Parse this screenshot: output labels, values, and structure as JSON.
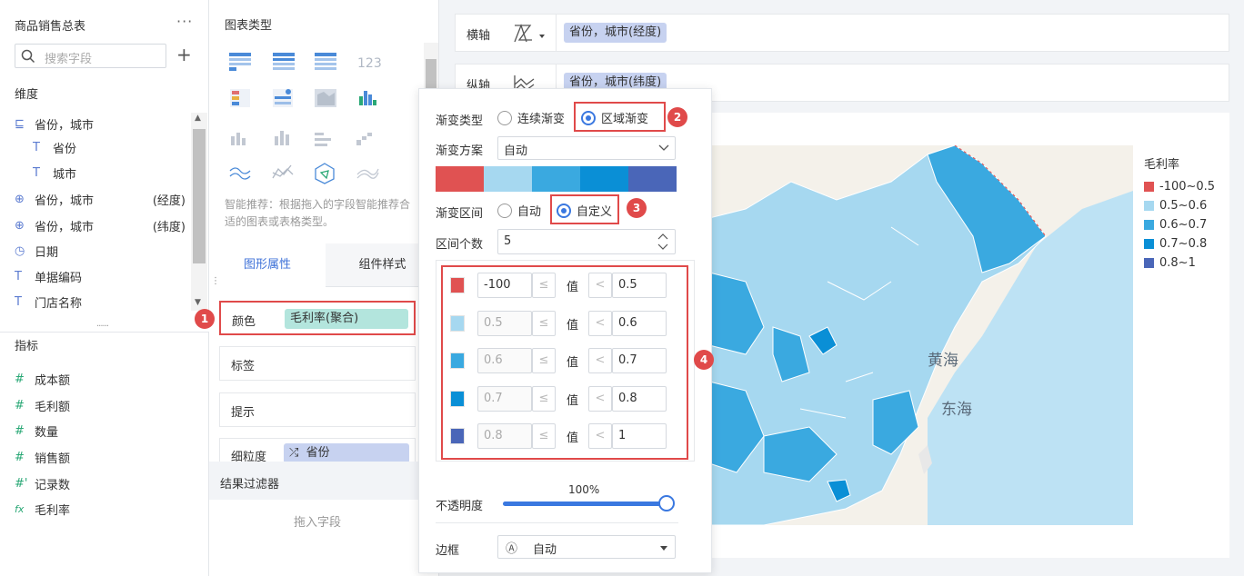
{
  "left": {
    "title": "商品销售总表",
    "more": "···",
    "search_placeholder": "搜索字段",
    "add": "+",
    "dim_label": "维度",
    "dims": [
      {
        "label": "省份，城市",
        "sub": "",
        "icon": "hierarchy-icon"
      },
      {
        "label": "省份",
        "sub": "",
        "icon": "text-field-icon"
      },
      {
        "label": "城市",
        "sub": "",
        "icon": "text-field-icon"
      },
      {
        "label": "省份，城市",
        "sub": "(经度)",
        "icon": "globe-icon"
      },
      {
        "label": "省份，城市",
        "sub": "(纬度)",
        "icon": "globe-icon"
      },
      {
        "label": "日期",
        "sub": "",
        "icon": "clock-icon"
      },
      {
        "label": "单据编码",
        "sub": "",
        "icon": "text-field-icon"
      },
      {
        "label": "门店名称",
        "sub": "",
        "icon": "text-field-icon"
      }
    ],
    "measure_label": "指标",
    "measures": [
      {
        "label": "成本额",
        "icon": "number-field-icon"
      },
      {
        "label": "毛利额",
        "icon": "number-field-icon"
      },
      {
        "label": "数量",
        "icon": "number-field-icon"
      },
      {
        "label": "销售额",
        "icon": "number-field-icon"
      },
      {
        "label": "记录数",
        "icon": "record-count-icon"
      },
      {
        "label": "毛利率",
        "icon": "formula-field-icon"
      }
    ]
  },
  "mid": {
    "title": "图表类型",
    "hint": "智能推荐：根据拖入的字段智能推荐合适的图表或表格类型。",
    "tab_graphic": "图形属性",
    "tab_component": "组件样式",
    "color_label": "颜色",
    "color_field": "毛利率(聚合)",
    "label_label": "标签",
    "tooltip_label": "提示",
    "granularity_label": "细粒度",
    "granularity_field": "省份",
    "filter_title": "结果过滤器",
    "drop_hint": "拖入字段"
  },
  "axes": {
    "x_label": "横轴",
    "x_field": "省份，城市(经度)",
    "y_label": "纵轴",
    "y_field": "省份，城市(纬度)"
  },
  "map": {
    "sea1": "黄海",
    "sea2": "东海"
  },
  "legend": {
    "title": "毛利率",
    "items": [
      {
        "label": "-100~0.5",
        "color": "#e05252"
      },
      {
        "label": "0.5~0.6",
        "color": "#a6d8f0"
      },
      {
        "label": "0.6~0.7",
        "color": "#3aa9e0"
      },
      {
        "label": "0.7~0.8",
        "color": "#0a8fd6"
      },
      {
        "label": "0.8~1",
        "color": "#4a66b8"
      }
    ]
  },
  "popup": {
    "gradient_type_label": "渐变类型",
    "opt_continuous": "连续渐变",
    "opt_region": "区域渐变",
    "scheme_label": "渐变方案",
    "scheme_value": "自动",
    "scheme_colors": [
      "#e05252",
      "#a6d8f0",
      "#3aa9e0",
      "#0a8fd6",
      "#4a66b8"
    ],
    "range_label": "渐变区间",
    "opt_auto": "自动",
    "opt_custom": "自定义",
    "count_label": "区间个数",
    "count_value": "5",
    "value_word": "值",
    "le": "≤",
    "lt": "<",
    "ranges": [
      {
        "color": "#e05252",
        "from": "-100",
        "to": "0.5",
        "from_editable": true
      },
      {
        "color": "#a6d8f0",
        "from": "0.5",
        "to": "0.6",
        "from_editable": false
      },
      {
        "color": "#3aa9e0",
        "from": "0.6",
        "to": "0.7",
        "from_editable": false
      },
      {
        "color": "#0a8fd6",
        "from": "0.7",
        "to": "0.8",
        "from_editable": false
      },
      {
        "color": "#4a66b8",
        "from": "0.8",
        "to": "1",
        "from_editable": false
      }
    ],
    "opacity_label": "不透明度",
    "opacity_value": "100%",
    "opacity_fraction": 1.0,
    "border_label": "边框",
    "border_value": "自动"
  },
  "badges": [
    "1",
    "2",
    "3",
    "4"
  ]
}
